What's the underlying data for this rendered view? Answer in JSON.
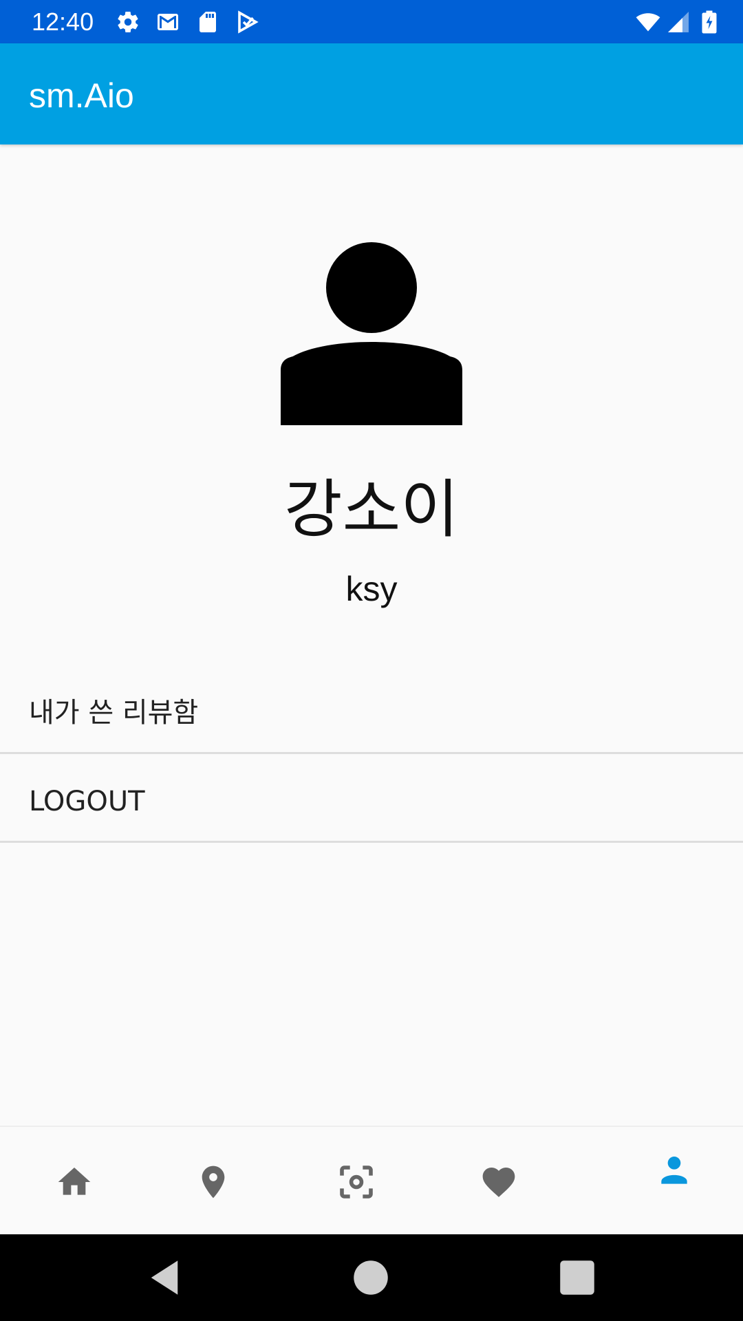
{
  "status_bar": {
    "time": "12:40",
    "left_icons": [
      "settings-icon",
      "gmail-icon",
      "sd-card-icon",
      "play-store-icon"
    ],
    "right_icons": [
      "wifi-icon",
      "cell-signal-icon",
      "battery-icon"
    ]
  },
  "app_bar": {
    "title": "sm.Aio"
  },
  "profile": {
    "name": "강소이",
    "user_id": "ksy"
  },
  "menu": [
    {
      "label": "내가 쓴 리뷰함"
    },
    {
      "label": "LOGOUT"
    }
  ],
  "bottom_nav": {
    "items": [
      "home-icon",
      "location-icon",
      "scan-icon",
      "heart-icon",
      "person-icon"
    ],
    "active": "person-icon"
  },
  "colors": {
    "status_bar": "#0060d6",
    "app_bar": "#00a0e2",
    "accent": "#0a97dd",
    "inactive_icon": "#666666"
  }
}
